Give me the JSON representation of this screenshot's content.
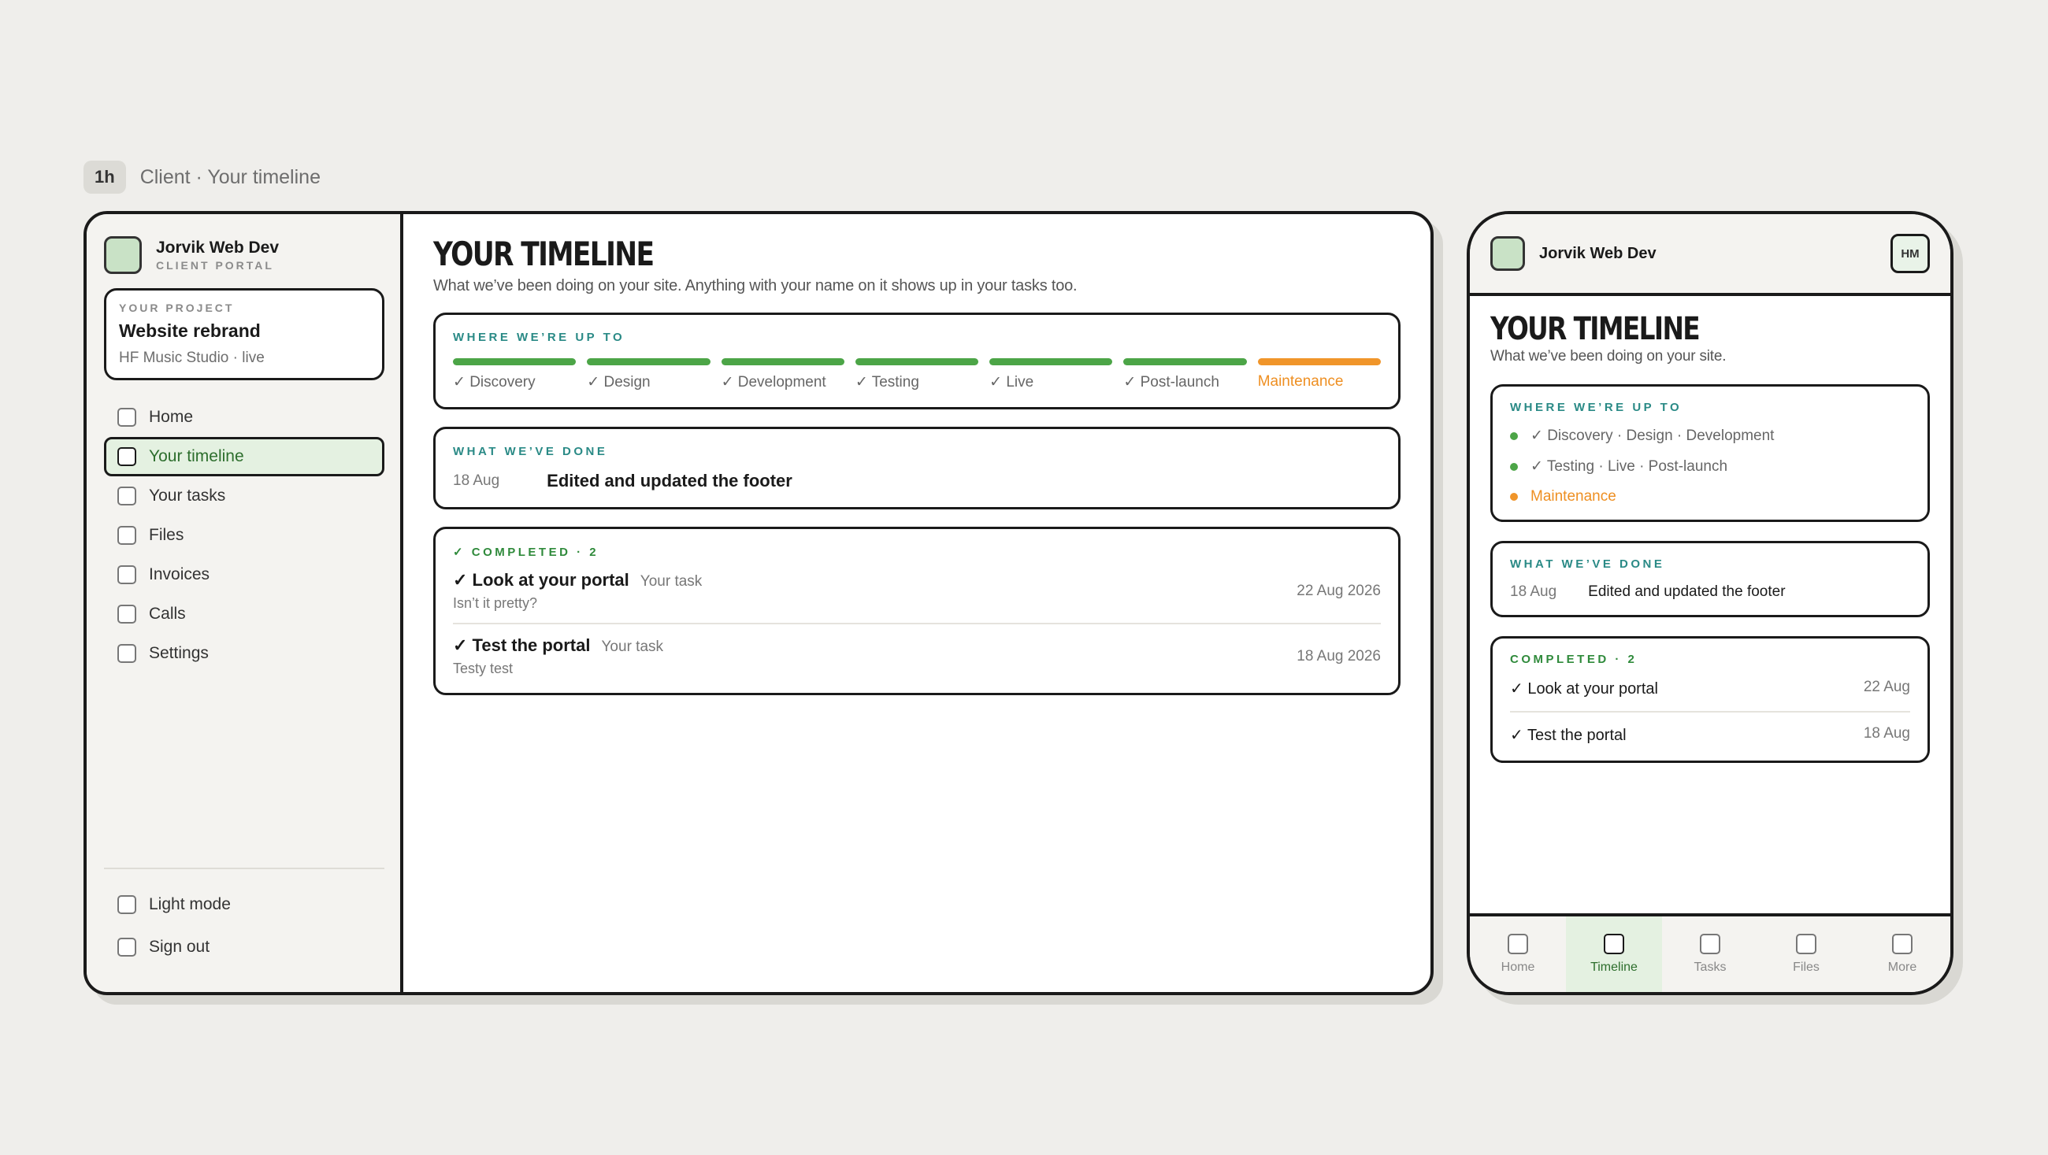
{
  "caption": {
    "badge": "1h",
    "text": "Client · Your timeline"
  },
  "desktop": {
    "brand": {
      "name": "Jorvik Web Dev",
      "sub": "CLIENT PORTAL"
    },
    "project": {
      "label": "YOUR PROJECT",
      "title": "Website rebrand",
      "sub": "HF Music Studio · live"
    },
    "nav": [
      {
        "label": "Home"
      },
      {
        "label": "Your timeline",
        "active": true
      },
      {
        "label": "Your tasks"
      },
      {
        "label": "Files"
      },
      {
        "label": "Invoices"
      },
      {
        "label": "Calls"
      },
      {
        "label": "Settings"
      }
    ],
    "bottom_nav": [
      {
        "label": "Light mode"
      },
      {
        "label": "Sign out"
      }
    ],
    "title": "YOUR TIMELINE",
    "lede": "What we’ve been doing on your site. Anything with your name on it shows up in your tasks too.",
    "progress": {
      "title": "WHERE WE’RE UP TO",
      "stages": [
        {
          "label": "✓ Discovery",
          "state": "done"
        },
        {
          "label": "✓ Design",
          "state": "done"
        },
        {
          "label": "✓ Development",
          "state": "done"
        },
        {
          "label": "✓ Testing",
          "state": "done"
        },
        {
          "label": "✓ Live",
          "state": "done"
        },
        {
          "label": "✓ Post-launch",
          "state": "done"
        },
        {
          "label": "Maintenance",
          "state": "current"
        }
      ]
    },
    "done": {
      "title": "WHAT WE’VE DONE",
      "items": [
        {
          "date": "18 Aug",
          "text": "Edited and updated the footer"
        }
      ]
    },
    "completed": {
      "title": "✓ COMPLETED · 2",
      "tasks": [
        {
          "title": "✓ Look at your portal",
          "tag": "Your task",
          "sub": "Isn’t it pretty?",
          "date": "22 Aug 2026"
        },
        {
          "title": "✓ Test the portal",
          "tag": "Your task",
          "sub": "Testy test",
          "date": "18 Aug 2026"
        }
      ]
    }
  },
  "mobile": {
    "brand": "Jorvik Web Dev",
    "avatar": "HM",
    "title": "YOUR TIMELINE",
    "lede": "What we’ve been doing on your site.",
    "progress": {
      "title": "WHERE WE’RE UP TO",
      "rows": [
        {
          "label": "✓ Discovery · Design · Development",
          "state": "done"
        },
        {
          "label": "✓ Testing · Live · Post-launch",
          "state": "done"
        },
        {
          "label": "Maintenance",
          "state": "current"
        }
      ]
    },
    "done": {
      "title": "WHAT WE’VE DONE",
      "date": "18 Aug",
      "text": "Edited and updated the footer"
    },
    "completed": {
      "title": "COMPLETED · 2",
      "tasks": [
        {
          "title": "✓ Look at your portal",
          "date": "22 Aug"
        },
        {
          "title": "✓ Test the portal",
          "date": "18 Aug"
        }
      ]
    },
    "tabs": [
      {
        "label": "Home"
      },
      {
        "label": "Timeline",
        "active": true
      },
      {
        "label": "Tasks"
      },
      {
        "label": "Files"
      },
      {
        "label": "More"
      }
    ]
  },
  "colors": {
    "accent_green": "#4ca547",
    "current_orange": "#f0952a",
    "active_bg": "#e4f1e1",
    "title_teal": "#2a8a86"
  }
}
